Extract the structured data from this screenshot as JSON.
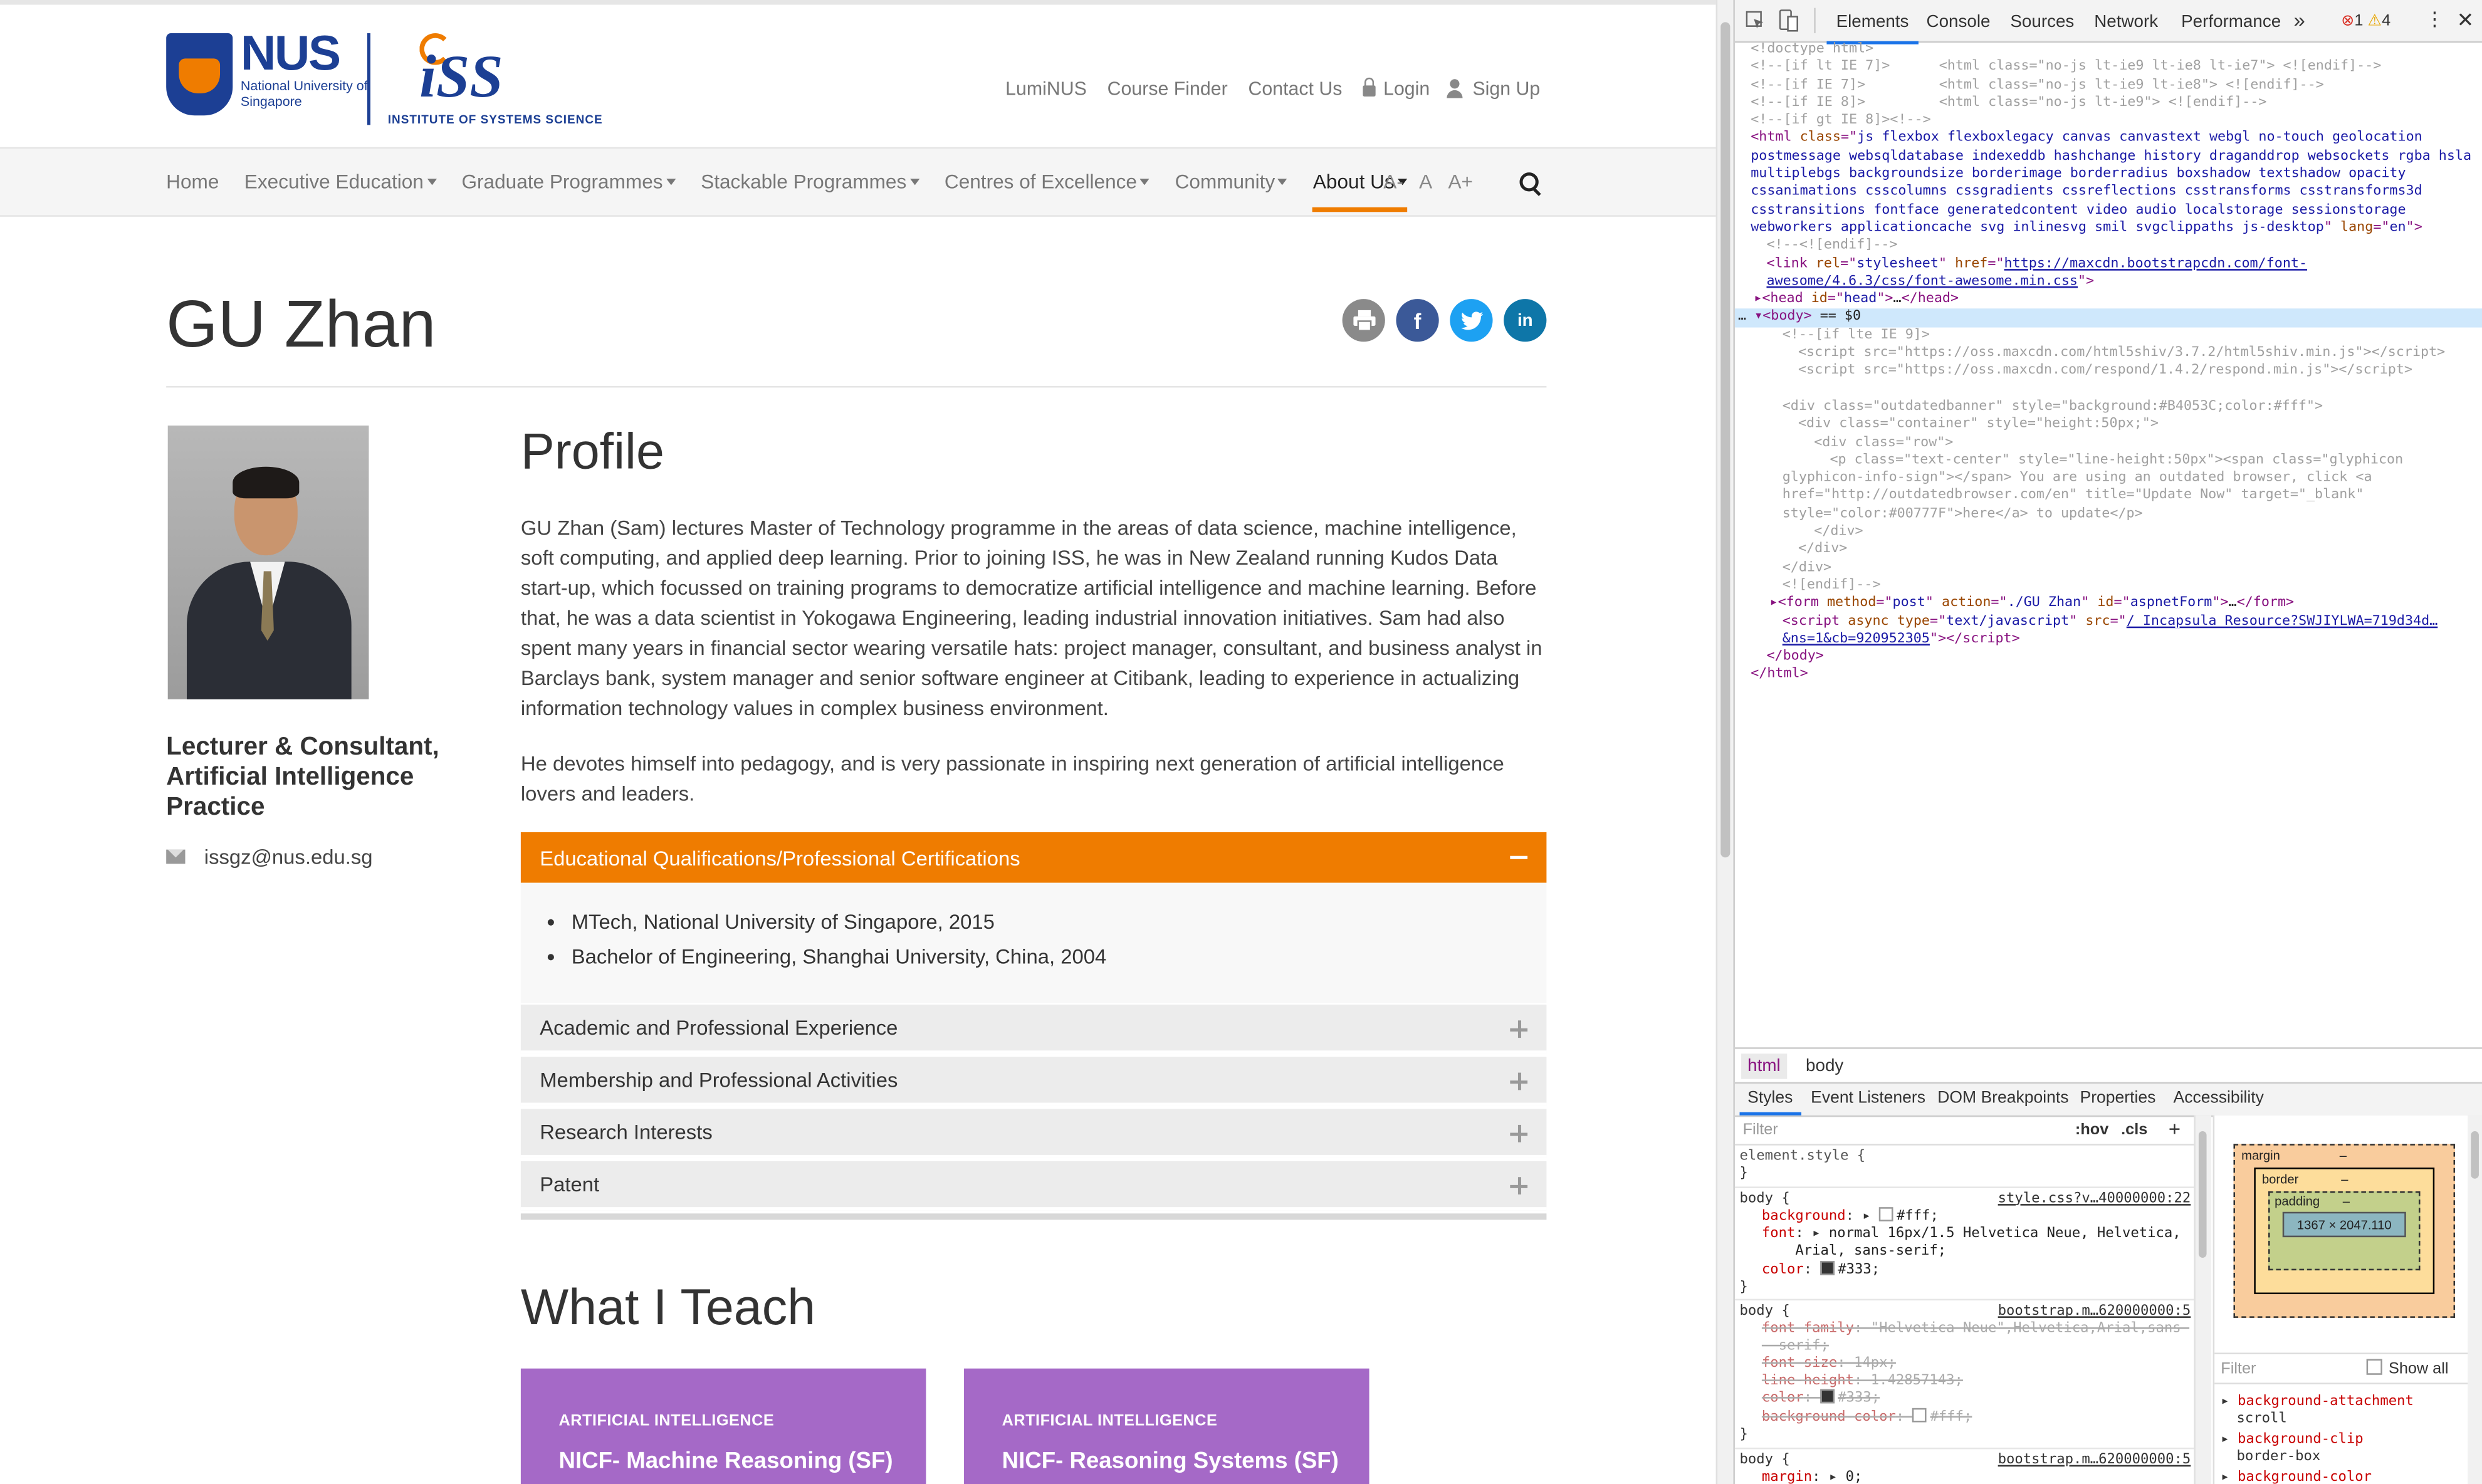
{
  "site": {
    "logos": {
      "nus_word": "NUS",
      "nus_sub": "National University of Singapore",
      "iss_word": "iSS",
      "iss_sub": "INSTITUTE OF SYSTEMS SCIENCE"
    },
    "util_links": [
      "LumiNUS",
      "Course Finder",
      "Contact Us",
      "Login",
      "Sign Up"
    ],
    "nav": [
      {
        "label": "Home",
        "caret": false
      },
      {
        "label": "Executive Education",
        "caret": true
      },
      {
        "label": "Graduate Programmes",
        "caret": true
      },
      {
        "label": "Stackable Programmes",
        "caret": true
      },
      {
        "label": "Centres of Excellence",
        "caret": true
      },
      {
        "label": "Community",
        "caret": true
      },
      {
        "label": "About Us",
        "caret": true,
        "active": true
      }
    ],
    "font_controls": [
      "A-",
      "A",
      "A+"
    ],
    "page_title": "GU Zhan",
    "share_icons": [
      "print-icon",
      "facebook-icon",
      "twitter-icon",
      "linkedin-icon"
    ],
    "share_glyphs": {
      "facebook": "f",
      "twitter": "t",
      "linkedin": "in"
    },
    "sidebar": {
      "role": "Lecturer & Consultant, Artificial Intelligence Practice",
      "email": "issgz@nus.edu.sg"
    },
    "profile": {
      "heading": "Profile",
      "paragraph_1": "GU Zhan (Sam) lectures Master of Technology programme in the areas of data science, machine intelligence, soft computing, and applied deep learning. Prior to joining ISS, he was in New Zealand running Kudos Data start-up, which focussed on training programs to democratize artificial intelligence and machine learning.  Before that, he was a data scientist in Yokogawa Engineering, leading industrial innovation initiatives.  Sam had also spent many years in financial sector wearing versatile hats: project manager, consultant, and business analyst in Barclays bank, system manager and senior software engineer at Citibank, leading to experience in actualizing information technology values in complex business environment.",
      "paragraph_2": "He devotes himself into pedagogy, and is very passionate in inspiring next generation of artificial intelligence lovers and leaders."
    },
    "accordion": {
      "open": {
        "title": "Educational Qualifications/Professional Certifications",
        "items": [
          "MTech, National University of Singapore, 2015",
          "Bachelor of Engineering, Shanghai University, China, 2004"
        ]
      },
      "closed": [
        "Academic and Professional Experience",
        "Membership and Professional Activities",
        "Research Interests",
        "Patent"
      ]
    },
    "teach": {
      "heading": "What I Teach",
      "cards": [
        {
          "category": "ARTIFICIAL INTELLIGENCE",
          "title": "NICF- Machine Reasoning (SF)"
        },
        {
          "category": "ARTIFICIAL INTELLIGENCE",
          "title": "NICF- Reasoning Systems (SF)"
        }
      ]
    },
    "colors": {
      "accent": "#ef7c00",
      "nus_blue": "#1c3f94",
      "card": "#a569c7"
    }
  },
  "devtools": {
    "tabs": [
      "Elements",
      "Console",
      "Sources",
      "Network",
      "Performance"
    ],
    "more": "»",
    "errors": "1",
    "warnings": "4",
    "breadcrumbs": [
      "html",
      "body"
    ],
    "styles_tabs": [
      "Styles",
      "Event Listeners",
      "DOM Breakpoints",
      "Properties",
      "Accessibility"
    ],
    "filter_placeholder": "Filter",
    "hov": ":hov",
    "cls": ".cls",
    "box_model": {
      "margin": "margin",
      "border": "border",
      "padding": "padding",
      "content": "1367 × 2047.110",
      "dash": "–"
    },
    "show_all": "Show all",
    "computed": [
      {
        "name": "background-attachment",
        "value": "scroll"
      },
      {
        "name": "background-clip",
        "value": "border-box"
      },
      {
        "name": "background-color",
        "value": ""
      }
    ]
  }
}
